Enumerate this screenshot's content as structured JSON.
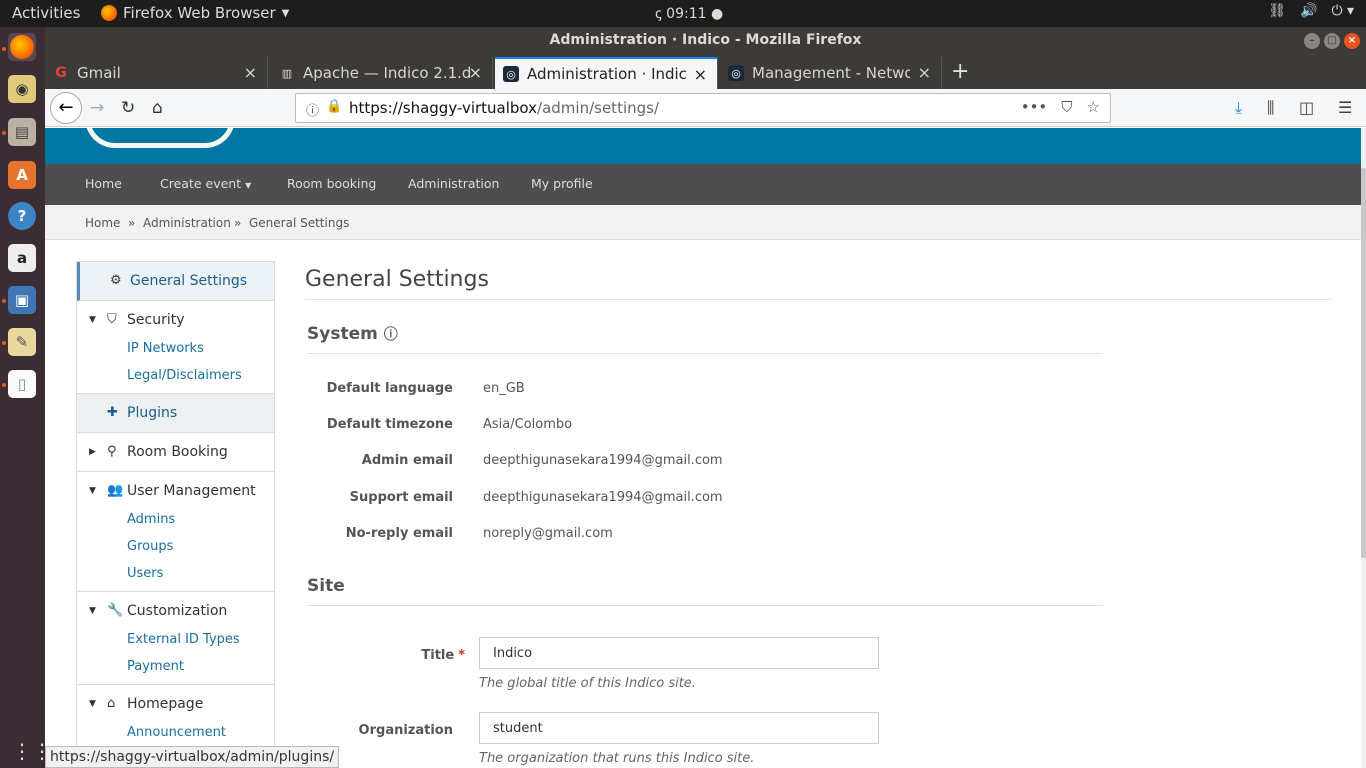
{
  "topbar": {
    "activities": "Activities",
    "app": "Firefox Web Browser",
    "time": "09:11"
  },
  "window": {
    "title": "Administration · Indico - Mozilla Firefox"
  },
  "tabs": [
    {
      "label": "Gmail"
    },
    {
      "label": "Apache — Indico 2.1.dev"
    },
    {
      "label": "Administration · Indico"
    },
    {
      "label": "Management - Network"
    }
  ],
  "url": {
    "host": "https://shaggy-virtualbox",
    "path": "/admin/settings/",
    "dots": "•••"
  },
  "menu": {
    "home": "Home",
    "create_event": "Create event",
    "room_booking": "Room booking",
    "administration": "Administration",
    "my_profile": "My profile"
  },
  "breadcrumb": {
    "home": "Home",
    "sep": "»",
    "admin": "Administration",
    "current": "General Settings"
  },
  "sidebar": {
    "general": "General Settings",
    "security": "Security",
    "ip_networks": "IP Networks",
    "legal": "Legal/Disclaimers",
    "plugins": "Plugins",
    "room_booking": "Room Booking",
    "user_mgmt": "User Management",
    "admins": "Admins",
    "groups": "Groups",
    "users": "Users",
    "customization": "Customization",
    "ext_id": "External ID Types",
    "payment": "Payment",
    "homepage": "Homepage",
    "announcement": "Announcement"
  },
  "main": {
    "title": "General Settings",
    "system": "System",
    "fields": [
      {
        "label": "Default language",
        "value": "en_GB"
      },
      {
        "label": "Default timezone",
        "value": "Asia/Colombo"
      },
      {
        "label": "Admin email",
        "value": "deepthigunasekara1994@gmail.com"
      },
      {
        "label": "Support email",
        "value": "deepthigunasekara1994@gmail.com"
      },
      {
        "label": "No-reply email",
        "value": "noreply@gmail.com"
      }
    ],
    "site": "Site",
    "title_label": "Title",
    "title_value": "Indico",
    "title_help": "The global title of this Indico site.",
    "org_label": "Organization",
    "org_value": "student",
    "org_help": "The organization that runs this Indico site."
  },
  "status_url": "https://shaggy-virtualbox/admin/plugins/",
  "colors": {
    "accent": "#0076a3",
    "menubar": "#4e4e4e",
    "link": "#1a6fa3"
  }
}
